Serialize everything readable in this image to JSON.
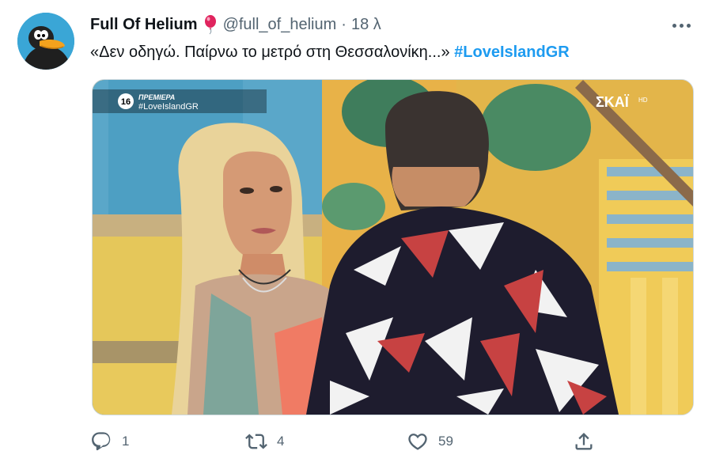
{
  "tweet": {
    "display_name": "Full Of Helium",
    "handle": "@full_of_helium",
    "separator": "·",
    "time": "18 λ",
    "text_plain": "«Δεν οδηγώ. Παίρνω το μετρό στη Θεσσαλονίκη...» ",
    "hashtag": "#LoveIslandGR"
  },
  "media": {
    "overlay_age_rating": "16",
    "overlay_premiere_label": "ΠΡΕΜΙΕΡΑ",
    "overlay_hashtag": "#LoveIslandGR",
    "channel_logo": "ΣΚΑΪ",
    "channel_logo_suffix": "HD"
  },
  "actions": {
    "reply_count": "1",
    "retweet_count": "4",
    "like_count": "59"
  },
  "icons": {
    "avatar": "daffy-duck-avatar",
    "name_badge": "red-balloon-icon",
    "more": "more-options-icon",
    "reply": "reply-icon",
    "retweet": "retweet-icon",
    "like": "heart-icon",
    "share": "share-icon"
  },
  "colors": {
    "hashtag": "#1d9bf0",
    "secondary_text": "#536471"
  }
}
